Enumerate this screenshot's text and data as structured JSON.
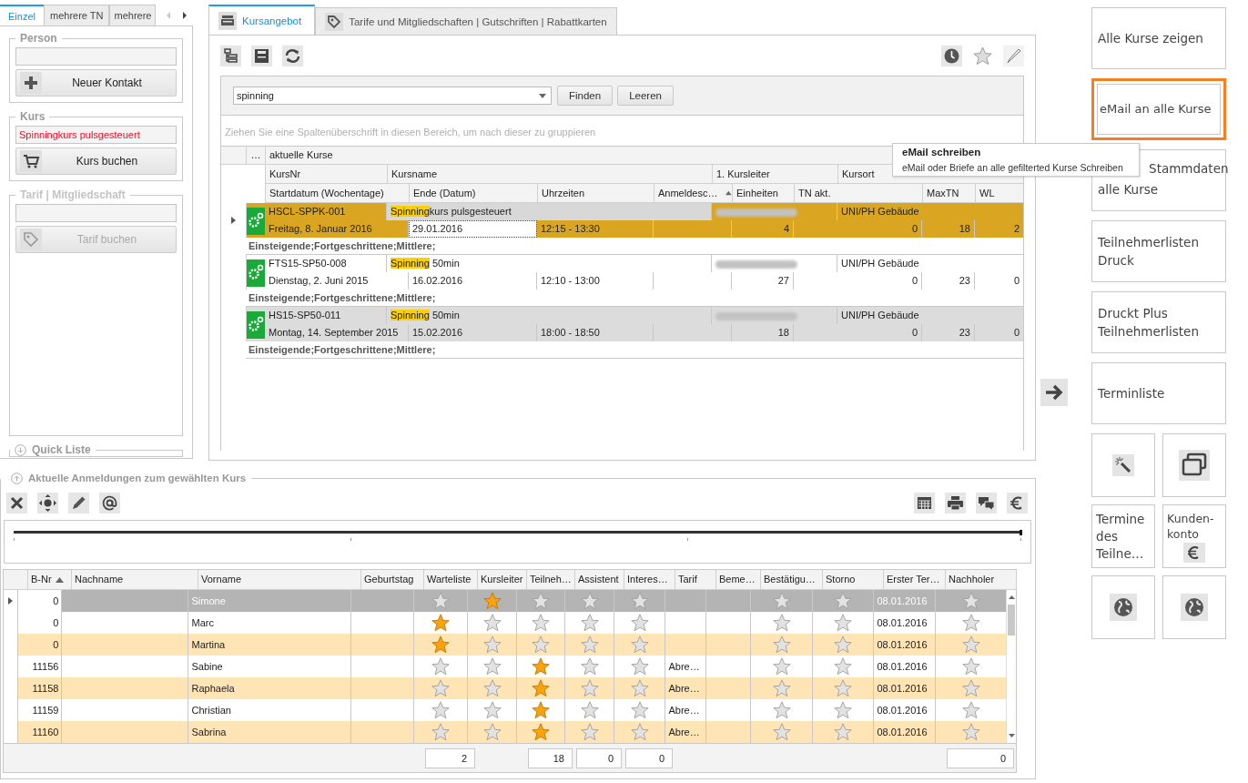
{
  "left_panel": {
    "tabs": [
      {
        "label": "Einzel",
        "selected": true
      },
      {
        "label": "mehrere TN",
        "selected": false
      },
      {
        "label": "mehrere",
        "selected": false
      }
    ],
    "person_section": {
      "title": "Person",
      "button": "Neuer Kontakt"
    },
    "course_section": {
      "title": "Kurs",
      "value": "Spinningkurs pulsgesteuert",
      "button": "Kurs buchen"
    },
    "tariff_section": {
      "title": "Tarif | Mitgliedschaft",
      "button": "Tarif buchen",
      "disabled": true
    },
    "quick_list": {
      "title": "Quick Liste"
    }
  },
  "center_panel": {
    "tabs": [
      {
        "label": "Kursangebot",
        "selected": true,
        "kind": "register"
      },
      {
        "label": "Tarife und Mitgliedschaften | Gutschriften | Rabattkarten",
        "selected": false,
        "kind": "tag"
      }
    ],
    "search": {
      "value": "spinning",
      "buttons": [
        "Finden",
        "Leeren"
      ]
    },
    "group_hint": "Ziehen Sie eine Spaltenüberschrift in diesen Bereich, um nach dieser zu gruppieren",
    "grid": {
      "band_menu": "…",
      "band": "aktuelle Kurse",
      "header_row_1": [
        "KursNr",
        "Kursname",
        "1. Kursleiter",
        "Kursort"
      ],
      "header_row_2": [
        {
          "label": "Startdatum (Wochentage)",
          "sorted": false
        },
        {
          "label": "Ende (Datum)",
          "sorted": false
        },
        {
          "label": "Uhrzeiten",
          "sorted": false
        },
        {
          "label": "Anmeldesc…",
          "sorted": true
        },
        {
          "label": "Einheiten",
          "sorted": false
        },
        {
          "label": "TN akt.",
          "sorted": false
        },
        {
          "label": "MaxTN",
          "sorted": false
        },
        {
          "label": "WL",
          "sorted": false
        }
      ],
      "rows": [
        {
          "selected": true,
          "kursnr": "HSCL-SPPK-001",
          "name_match": "Spinning",
          "name_rest": "kurs pulsgesteuert",
          "kursort": "UNI/PH Gebäude",
          "start": "Freitag, 8. Januar 2016",
          "ende": "29.01.2016",
          "zeiten": "12:15 - 13:30",
          "einheiten": "4",
          "tn": "0",
          "max": "18",
          "wl": "2",
          "zielgruppe": "Einsteigende;Fortgeschrittene;Mittlere;"
        },
        {
          "selected": false,
          "kursnr": "FTS15-SP50-008",
          "name_match": "Spinning",
          "name_rest": " 50min",
          "kursort": "UNI/PH Gebäude",
          "start": "Dienstag, 2. Juni 2015",
          "ende": "16.02.2016",
          "zeiten": "12:10 - 13:00",
          "einheiten": "27",
          "tn": "0",
          "max": "23",
          "wl": "0",
          "zielgruppe": "Einsteigende;Fortgeschrittene;Mittlere;"
        },
        {
          "selected": false,
          "kursnr": "HS15-SP50-011",
          "name_match": "Spinning",
          "name_rest": " 50min",
          "kursort": "UNI/PH Gebäude",
          "start": "Montag, 14. September 2015",
          "ende": "15.02.2016",
          "zeiten": "18:00 - 18:50",
          "einheiten": "18",
          "tn": "0",
          "max": "23",
          "wl": "0",
          "zielgruppe": "Einsteigende;Fortgeschrittene;Mittlere;"
        }
      ]
    }
  },
  "registrations": {
    "title": "Aktuelle Anmeldungen zum gewählten Kurs",
    "columns": [
      {
        "label": "B-Nr",
        "kind": "text",
        "sorted": true
      },
      {
        "label": "Nachname",
        "kind": "text"
      },
      {
        "label": "Vorname",
        "kind": "text"
      },
      {
        "label": "Geburtstag",
        "kind": "text"
      },
      {
        "label": "Warteliste",
        "kind": "star",
        "total": "2"
      },
      {
        "label": "Kursleiter",
        "kind": "star"
      },
      {
        "label": "Teilneh…",
        "kind": "star",
        "total": "18"
      },
      {
        "label": "Assistent",
        "kind": "star",
        "total": "0"
      },
      {
        "label": "Interes…",
        "kind": "star",
        "total": "0"
      },
      {
        "label": "Tarif",
        "kind": "text"
      },
      {
        "label": "Beme…",
        "kind": "text"
      },
      {
        "label": "Bestätigu…",
        "kind": "star"
      },
      {
        "label": "Storno",
        "kind": "star"
      },
      {
        "label": "Erster Ter…",
        "kind": "text"
      },
      {
        "label": "Nachholer",
        "kind": "star",
        "total": "0"
      }
    ],
    "rows": [
      {
        "selected": true,
        "cells": [
          {
            "text": "0"
          },
          {},
          {
            "text": "Simone"
          },
          {},
          {
            "checked": false
          },
          {
            "checked": true
          },
          {
            "checked": false
          },
          {
            "checked": false
          },
          {
            "checked": false
          },
          {},
          {},
          {
            "checked": false
          },
          {
            "checked": false
          },
          {
            "text": "08.01.2016"
          },
          {
            "checked": false
          }
        ]
      },
      {
        "selected": false,
        "cells": [
          {
            "text": "0"
          },
          {},
          {
            "text": "Marc"
          },
          {},
          {
            "checked": true
          },
          {
            "checked": false
          },
          {
            "checked": false
          },
          {
            "checked": false
          },
          {
            "checked": false
          },
          {},
          {},
          {
            "checked": false
          },
          {
            "checked": false
          },
          {
            "text": "08.01.2016"
          },
          {
            "checked": false
          }
        ]
      },
      {
        "selected": false,
        "cells": [
          {
            "text": "0"
          },
          {},
          {
            "text": "Martina"
          },
          {},
          {
            "checked": true
          },
          {
            "checked": false
          },
          {
            "checked": false
          },
          {
            "checked": false
          },
          {
            "checked": false
          },
          {},
          {},
          {
            "checked": false
          },
          {
            "checked": false
          },
          {
            "text": "08.01.2016"
          },
          {
            "checked": false
          }
        ]
      },
      {
        "selected": false,
        "cells": [
          {
            "text": "11156"
          },
          {},
          {
            "text": "Sabine"
          },
          {},
          {
            "checked": false
          },
          {
            "checked": false
          },
          {
            "checked": true
          },
          {
            "checked": false
          },
          {
            "checked": false
          },
          {
            "text": "Abre…"
          },
          {},
          {
            "checked": false
          },
          {
            "checked": false
          },
          {
            "text": "08.01.2016"
          },
          {
            "checked": false
          }
        ]
      },
      {
        "selected": false,
        "cells": [
          {
            "text": "11158"
          },
          {},
          {
            "text": "Raphaela"
          },
          {},
          {
            "checked": false
          },
          {
            "checked": false
          },
          {
            "checked": true
          },
          {
            "checked": false
          },
          {
            "checked": false
          },
          {
            "text": "Abre…"
          },
          {},
          {
            "checked": false
          },
          {
            "checked": false
          },
          {
            "text": "08.01.2016"
          },
          {
            "checked": false
          }
        ]
      },
      {
        "selected": false,
        "cells": [
          {
            "text": "11159"
          },
          {},
          {
            "text": "Christian"
          },
          {},
          {
            "checked": false
          },
          {
            "checked": false
          },
          {
            "checked": true
          },
          {
            "checked": false
          },
          {
            "checked": false
          },
          {
            "text": "Abre…"
          },
          {},
          {
            "checked": false
          },
          {
            "checked": false
          },
          {
            "text": "08.01.2016"
          },
          {
            "checked": false
          }
        ]
      },
      {
        "selected": false,
        "cells": [
          {
            "text": "11160"
          },
          {},
          {
            "text": "Sabrina"
          },
          {},
          {
            "checked": false
          },
          {
            "checked": false
          },
          {
            "checked": true
          },
          {
            "checked": false
          },
          {
            "checked": false
          },
          {
            "text": "Abre…"
          },
          {},
          {
            "checked": false
          },
          {
            "checked": false
          },
          {
            "text": "08.01.2016"
          },
          {
            "checked": false
          }
        ]
      }
    ]
  },
  "action_buttons": [
    {
      "kind": "text",
      "label": "Alle Kurse zeigen",
      "highlighted": false
    },
    {
      "kind": "text",
      "label": "eMail an alle Kurse",
      "highlighted": true
    },
    {
      "kind": "partly_covered",
      "label": "Stammdaten alle Kurse",
      "highlighted": false
    },
    {
      "kind": "text",
      "label": "Teilnehmerlisten Druck",
      "highlighted": false
    },
    {
      "kind": "text",
      "label": "Druckt Plus Teilnehmerlisten",
      "highlighted": false
    },
    {
      "kind": "text",
      "label": "Terminliste",
      "highlighted": false
    }
  ],
  "small_buttons": [
    {
      "kind": "wand"
    },
    {
      "kind": "windows"
    },
    {
      "kind": "text",
      "label": "Termine des Teilne…"
    },
    {
      "kind": "text_euro",
      "label": "Kunden-konto"
    },
    {
      "kind": "globe"
    },
    {
      "kind": "globe"
    }
  ],
  "tooltip": {
    "title": "eMail schreiben",
    "text": "eMail oder Briefe an alle gefilterted Kurse Schreiben"
  }
}
